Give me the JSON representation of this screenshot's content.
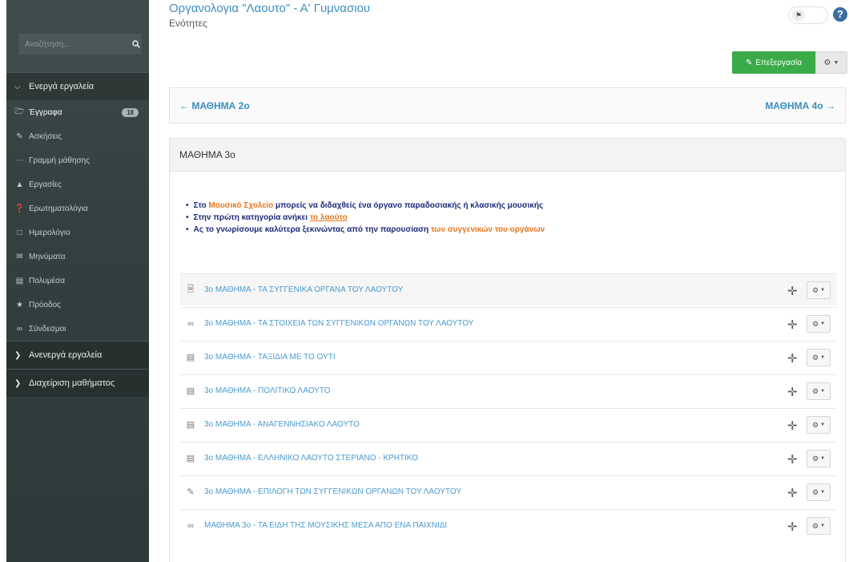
{
  "page": {
    "title": "Οργανολογια \"Λαουτο\" - Α' Γυμνασιου",
    "subtitle": "Ενότητες",
    "edit_label": "Επεξεργασία",
    "help_symbol": "?"
  },
  "sidebar": {
    "search_placeholder": "Αναζήτηση...",
    "active_section": "Ενεργά εργαλεία",
    "items": [
      {
        "label": "Έγγραφα",
        "icon": "folder-icon",
        "badge": "18"
      },
      {
        "label": "Ασκήσεις",
        "icon": "edit-icon"
      },
      {
        "label": "Γραμμή μάθησης",
        "icon": "ellipsis-icon"
      },
      {
        "label": "Εργασίες",
        "icon": "flask-icon"
      },
      {
        "label": "Ερωτηματολόγια",
        "icon": "question-icon"
      },
      {
        "label": "Ημερολόγιο",
        "icon": "calendar-icon"
      },
      {
        "label": "Μηνύματα",
        "icon": "envelope-icon"
      },
      {
        "label": "Πολυμέσα",
        "icon": "film-icon"
      },
      {
        "label": "Πρόοδος",
        "icon": "trophy-icon"
      },
      {
        "label": "Σύνδεσμοι",
        "icon": "link-icon"
      }
    ],
    "inactive_section": "Ανενεργά εργαλεία",
    "admin_section": "Διαχείριση μαθήματος"
  },
  "nav": {
    "prev": "ΜΑΘΗΜΑ 2ο",
    "next": "ΜΑΘΗΜΑ 4ο"
  },
  "lesson": {
    "heading": "ΜΑΘΗΜΑ 3ο",
    "intro": {
      "line1_a": "Στο ",
      "line1_b": "Μουσικό Σχολείο",
      "line1_c": " μπορείς να διδαχθείς ένα όργανο παραδοσιακής ή κλασικής μουσικής",
      "line2_a": "Στην πρώτη κατηγορία ανήκει ",
      "line2_b": "το λαούτο",
      "line3_a": "Ας το γνωρίσουμε καλύτερα ξεκινώντας από την παρουσίαση ",
      "line3_b": "των συγγενικών του οργάνων"
    },
    "resources": [
      {
        "label": "3ο ΜΑΘΗΜΑ - ΤΑ ΣΥΓΓΕΝΙΚΑ ΟΡΓΑΝΑ ΤΟΥ ΛΑΟΥΤΟΥ",
        "icon": "pdf-file-icon"
      },
      {
        "label": "3ο ΜΑΘΗΜΑ - ΤΑ ΣΤΟΙΧΕΙΑ ΤΩΝ ΣΥΓΓΕΝΙΚΩΝ ΟΡΓΑΝΩΝ ΤΟΥ ΛΑΟΥΤΟΥ",
        "icon": "link-icon"
      },
      {
        "label": "3ο ΜΑΘΗΜΑ - ΤΑΞΙΔΙΑ ΜΕ ΤΟ ΟΥΤΙ",
        "icon": "film-icon"
      },
      {
        "label": "3ο ΜΑΘΗΜΑ - ΠΟΛΙΤΙΚΟ ΛΑΟΥΤΟ",
        "icon": "film-icon"
      },
      {
        "label": "3ο ΜΑΘΗΜΑ - ΑΝΑΓΕΝΝΗΣΙΑΚΟ ΛΑΟΥΤΟ",
        "icon": "film-icon"
      },
      {
        "label": "3ο ΜΑΘΗΜΑ - ΕΛΛΗΝΙΚΟ ΛΑΟΥΤΟ ΣΤΕΡΙΑΝΟ - ΚΡΗΤΙΚΟ",
        "icon": "film-icon"
      },
      {
        "label": "3ο ΜΑΘΗΜΑ - ΕΠΙΛΟΓΗ ΤΩΝ ΣΥΓΓΕΝΙΚΩΝ ΟΡΓΑΝΩΝ ΤΟΥ ΛΑΟΥΤΟΥ",
        "icon": "edit-icon"
      },
      {
        "label": "ΜΑΘΗΜΑ 3ο - ΤΑ ΕΙΔΗ ΤΗΣ ΜΟΥΣΙΚΗΣ ΜΕΣΑ ΑΠΟ ΕΝΑ ΠΑΙΧΝΙΔΙ",
        "icon": "link-icon"
      }
    ]
  },
  "colors": {
    "sidebar_bg": "#34403f",
    "link": "#3b8ec0",
    "edit_button": "#3aab48",
    "intro_text": "#1c2a7a",
    "intro_highlight": "#e8761c"
  }
}
